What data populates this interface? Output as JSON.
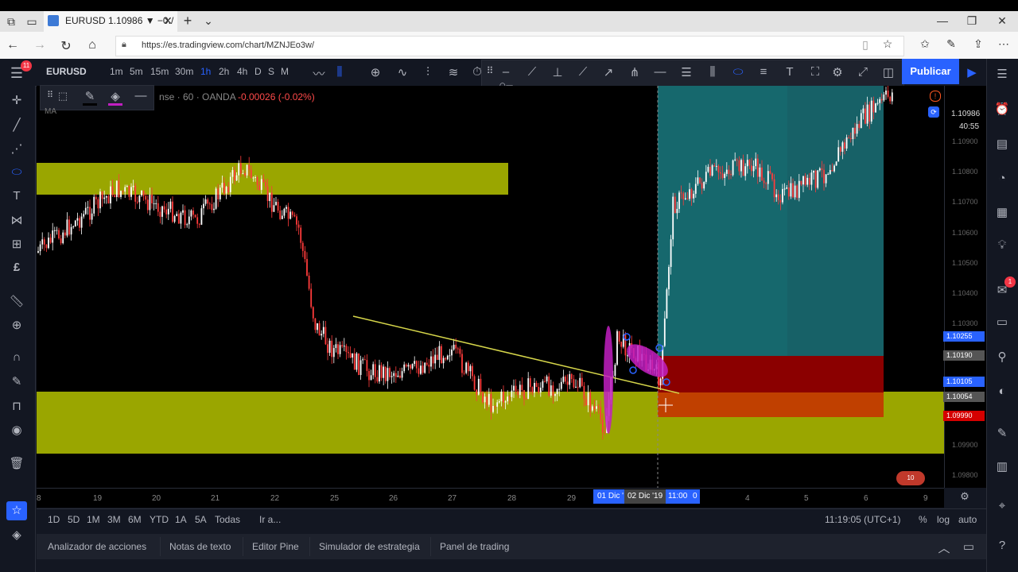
{
  "browser": {
    "tab_title": "EURUSD 1.10986 ▼ −0./",
    "url": "https://es.tradingview.com/chart/MZNJEo3w/"
  },
  "toolbar": {
    "symbol": "EURUSD",
    "intervals": [
      "1m",
      "5m",
      "15m",
      "30m",
      "1h",
      "2h",
      "4h",
      "D",
      "S",
      "M"
    ],
    "active_interval": "1h",
    "publish_label": "Publicar",
    "menu_badge": "11"
  },
  "legend": {
    "source": "nse · 60 · OANDA",
    "change": "-0.00026 (-0.02%)",
    "indicator": "MA"
  },
  "price_scale": {
    "labels": [
      "1.10900",
      "1.10800",
      "1.10700",
      "1.10600",
      "1.10500",
      "1.10400",
      "1.10300",
      "1.10000",
      "1.09900",
      "1.09800"
    ],
    "current_price": "1.10986",
    "countdown": "40:55",
    "tags": [
      {
        "value": "1.10255",
        "color": "#2962ff"
      },
      {
        "value": "1.10190",
        "color": "#555555"
      },
      {
        "value": "1.10105",
        "color": "#2962ff"
      },
      {
        "value": "1.10054",
        "color": "#555555"
      },
      {
        "value": "1.09990",
        "color": "#d50000"
      }
    ]
  },
  "time_scale": {
    "labels": [
      "8",
      "19",
      "20",
      "21",
      "22",
      "25",
      "26",
      "27",
      "28",
      "29",
      "4",
      "5",
      "6",
      "9"
    ],
    "highlight": "01 Dic '",
    "highlight2": "02 Dic '19",
    "highlight_time": "11:00",
    "highlight_tail": "0"
  },
  "range_bar": {
    "ranges": [
      "1D",
      "5D",
      "1M",
      "3M",
      "6M",
      "YTD",
      "1A",
      "5A",
      "Todas"
    ],
    "goto": "Ir a...",
    "clock": "11:19:05 (UTC+1)",
    "percent": "%",
    "log": "log",
    "auto": "auto"
  },
  "bottom_tabs": [
    "Analizador de acciones",
    "Notas de texto",
    "Editor Pine",
    "Simulador de estrategia",
    "Panel de trading"
  ],
  "right_badge": "1",
  "chart_watermark_badge": "10",
  "colors": {
    "zone": "#9aa600",
    "bull": "#ffffff",
    "bear": "#ff3b3b",
    "target": "#1a7a80",
    "stop": "#8b0000",
    "stop_orange": "#c04000",
    "trendline": "#d6d64a",
    "ellipse": "#c21fc2"
  }
}
